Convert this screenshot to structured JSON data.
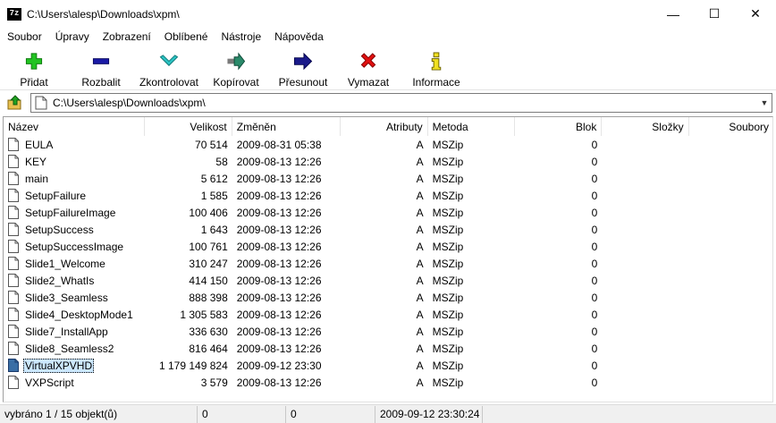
{
  "window": {
    "title": "C:\\Users\\alesp\\Downloads\\xpm\\",
    "app_icon_text": "7z",
    "minimize": "—",
    "maximize": "☐",
    "close": "✕"
  },
  "menu": [
    "Soubor",
    "Úpravy",
    "Zobrazení",
    "Oblíbené",
    "Nástroje",
    "Nápověda"
  ],
  "toolbar": {
    "add": "Přidat",
    "extract": "Rozbalit",
    "test": "Zkontrolovat",
    "copy": "Kopírovat",
    "move": "Přesunout",
    "delete": "Vymazat",
    "info": "Informace"
  },
  "address": {
    "path": "C:\\Users\\alesp\\Downloads\\xpm\\"
  },
  "columns": {
    "name": "Název",
    "size": "Velikost",
    "modified": "Změněn",
    "attributes": "Atributy",
    "method": "Metoda",
    "block": "Blok",
    "folders": "Složky",
    "files": "Soubory"
  },
  "files": [
    {
      "name": "EULA",
      "size": "70 514",
      "modified": "2009-08-31 05:38",
      "attr": "A",
      "method": "MSZip",
      "block": "0"
    },
    {
      "name": "KEY",
      "size": "58",
      "modified": "2009-08-13 12:26",
      "attr": "A",
      "method": "MSZip",
      "block": "0"
    },
    {
      "name": "main",
      "size": "5 612",
      "modified": "2009-08-13 12:26",
      "attr": "A",
      "method": "MSZip",
      "block": "0"
    },
    {
      "name": "SetupFailure",
      "size": "1 585",
      "modified": "2009-08-13 12:26",
      "attr": "A",
      "method": "MSZip",
      "block": "0"
    },
    {
      "name": "SetupFailureImage",
      "size": "100 406",
      "modified": "2009-08-13 12:26",
      "attr": "A",
      "method": "MSZip",
      "block": "0"
    },
    {
      "name": "SetupSuccess",
      "size": "1 643",
      "modified": "2009-08-13 12:26",
      "attr": "A",
      "method": "MSZip",
      "block": "0"
    },
    {
      "name": "SetupSuccessImage",
      "size": "100 761",
      "modified": "2009-08-13 12:26",
      "attr": "A",
      "method": "MSZip",
      "block": "0"
    },
    {
      "name": "Slide1_Welcome",
      "size": "310 247",
      "modified": "2009-08-13 12:26",
      "attr": "A",
      "method": "MSZip",
      "block": "0"
    },
    {
      "name": "Slide2_WhatIs",
      "size": "414 150",
      "modified": "2009-08-13 12:26",
      "attr": "A",
      "method": "MSZip",
      "block": "0"
    },
    {
      "name": "Slide3_Seamless",
      "size": "888 398",
      "modified": "2009-08-13 12:26",
      "attr": "A",
      "method": "MSZip",
      "block": "0"
    },
    {
      "name": "Slide4_DesktopMode1",
      "size": "1 305 583",
      "modified": "2009-08-13 12:26",
      "attr": "A",
      "method": "MSZip",
      "block": "0"
    },
    {
      "name": "Slide7_InstallApp",
      "size": "336 630",
      "modified": "2009-08-13 12:26",
      "attr": "A",
      "method": "MSZip",
      "block": "0"
    },
    {
      "name": "Slide8_Seamless2",
      "size": "816 464",
      "modified": "2009-08-13 12:26",
      "attr": "A",
      "method": "MSZip",
      "block": "0"
    },
    {
      "name": "VirtualXPVHD",
      "size": "1 179 149 824",
      "modified": "2009-09-12 23:30",
      "attr": "A",
      "method": "MSZip",
      "block": "0",
      "selected": true
    },
    {
      "name": "VXPScript",
      "size": "3 579",
      "modified": "2009-08-13 12:26",
      "attr": "A",
      "method": "MSZip",
      "block": "0"
    }
  ],
  "status": {
    "selection": "vybráno 1 / 15 objekt(ů)",
    "size": "0",
    "packed": "0",
    "modified": "2009-09-12 23:30:24"
  },
  "colors": {
    "add": "#21c321",
    "extract": "#1a1aa6",
    "test": "#2bc3c3",
    "copy": "#2a8a6a",
    "move": "#1a1a8a",
    "delete": "#e01010",
    "info": "#f0e020"
  }
}
